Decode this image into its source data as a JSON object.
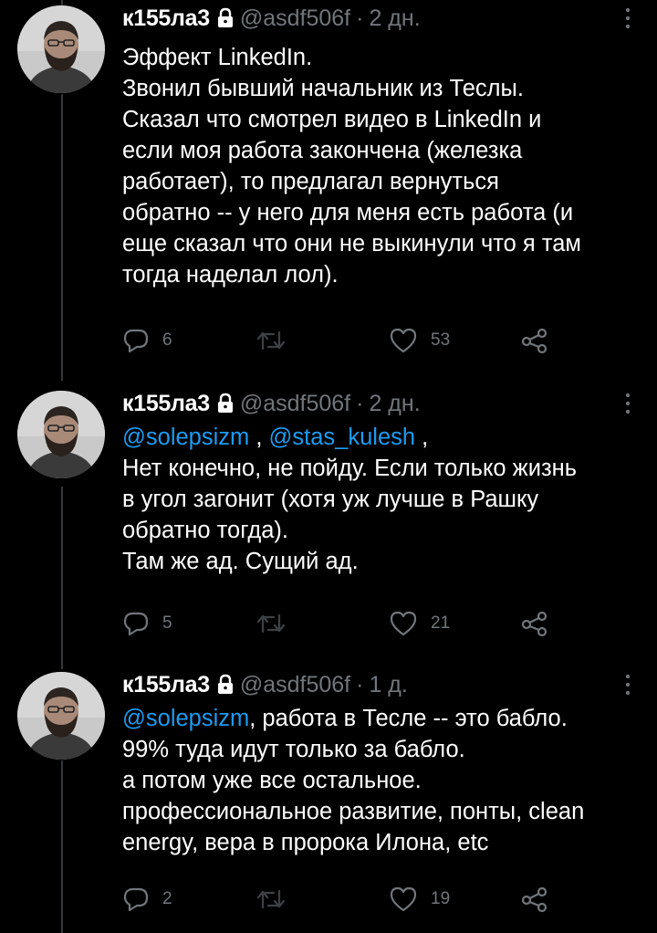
{
  "tweets": [
    {
      "display_name": "к155ла3",
      "handle": "@asdf506f",
      "sep": "·",
      "time": "2 дн.",
      "lines": [
        "Эффект LinkedIn.",
        "Звонил бывший начальник из Теслы.",
        "Сказал что смотрел видео в LinkedIn и",
        "если моя работа закончена (железка",
        "работает), то предлагал вернуться",
        "обратно -- у него для меня есть работа (и",
        "еще сказал что они не выкинули что я там",
        "тогда наделал лол)."
      ],
      "replies": "6",
      "likes": "53"
    },
    {
      "display_name": "к155ла3",
      "handle": "@asdf506f",
      "sep": "·",
      "time": "2 дн.",
      "mention1": "@solepsizm",
      "mention_sep": " , ",
      "mention2": "@stas_kulesh",
      "mention_end": " ,",
      "lines": [
        "Нет конечно, не пойду. Если только жизнь",
        "в угол загонит (хотя уж лучше в Рашку",
        "обратно тогда).",
        "Там же ад. Сущий ад."
      ],
      "replies": "5",
      "likes": "21"
    },
    {
      "display_name": "к155ла3",
      "handle": "@asdf506f",
      "sep": "·",
      "time": "1 д.",
      "mention1": "@solepsizm",
      "first_line_rest": ", работа в Тесле -- это бабло.",
      "lines": [
        "99% туда идут только за бабло.",
        "а потом уже все остальное.",
        "профессиональное развитие, понты, clean",
        "energy, вера в пророка Илона, etc"
      ],
      "replies": "2",
      "likes": "19"
    }
  ],
  "colors": {
    "background": "#000000",
    "text": "#ffffff",
    "secondary": "#71767b",
    "link": "#1d9bf0",
    "thread_line": "#333639"
  },
  "icons": [
    "lock-icon",
    "more-icon",
    "reply-icon",
    "retweet-icon",
    "like-icon",
    "share-icon"
  ]
}
